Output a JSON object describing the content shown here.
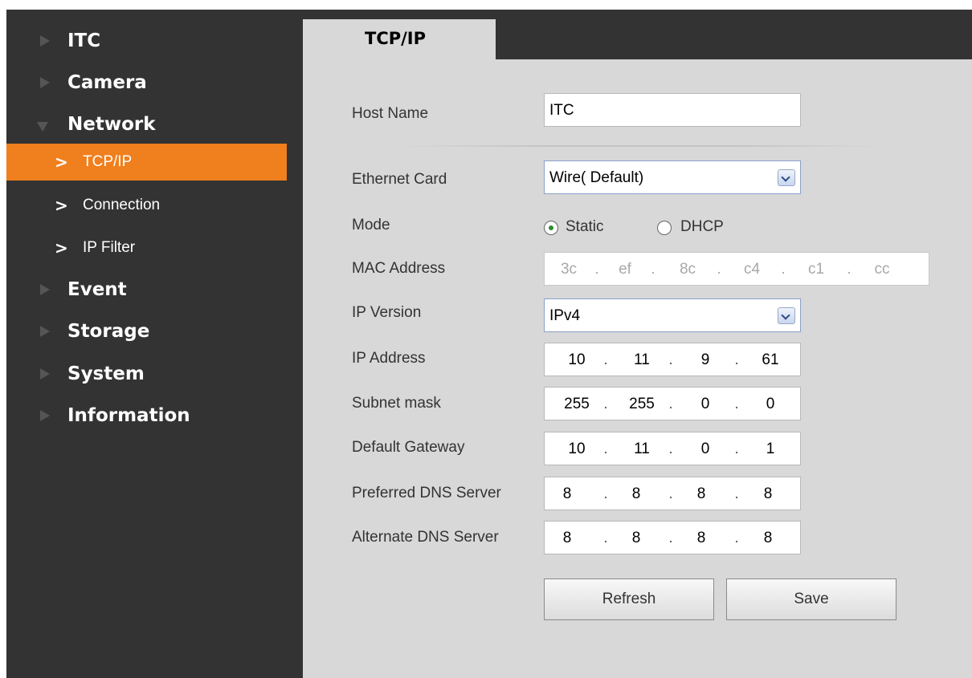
{
  "sidebar": {
    "items": [
      {
        "label": "ITC",
        "expanded": false
      },
      {
        "label": "Camera",
        "expanded": false
      },
      {
        "label": "Network",
        "expanded": true
      },
      {
        "label": "TCP/IP",
        "sub": true,
        "active": true
      },
      {
        "label": "Connection",
        "sub": true,
        "active": false
      },
      {
        "label": "IP Filter",
        "sub": true,
        "active": false
      },
      {
        "label": "Event",
        "expanded": false
      },
      {
        "label": "Storage",
        "expanded": false
      },
      {
        "label": "System",
        "expanded": false
      },
      {
        "label": "Information",
        "expanded": false
      }
    ]
  },
  "tab": {
    "label": "TCP/IP"
  },
  "form": {
    "host_name": {
      "label": "Host Name",
      "value": "ITC"
    },
    "ethernet_card": {
      "label": "Ethernet Card",
      "value": "Wire( Default)"
    },
    "mode": {
      "label": "Mode",
      "options": [
        "Static",
        "DHCP"
      ],
      "selected": "Static"
    },
    "mac_address": {
      "label": "MAC Address",
      "parts": [
        "3c",
        "ef",
        "8c",
        "c4",
        "c1",
        "cc"
      ]
    },
    "ip_version": {
      "label": "IP Version",
      "value": "IPv4"
    },
    "ip_address": {
      "label": "IP Address",
      "parts": [
        "10",
        "11",
        "9",
        "61"
      ]
    },
    "subnet_mask": {
      "label": "Subnet mask",
      "parts": [
        "255",
        "255",
        "0",
        "0"
      ]
    },
    "default_gateway": {
      "label": "Default Gateway",
      "parts": [
        "10",
        "11",
        "0",
        "1"
      ]
    },
    "preferred_dns": {
      "label": "Preferred DNS Server",
      "parts": [
        "8",
        "8",
        "8",
        "8"
      ]
    },
    "alternate_dns": {
      "label": "Alternate DNS Server",
      "parts": [
        "8",
        "8",
        "8",
        "8"
      ]
    }
  },
  "buttons": {
    "refresh": "Refresh",
    "save": "Save"
  },
  "colors": {
    "sidebar_bg": "#333333",
    "active_item": "#f07f1e",
    "content_bg": "#d8d8d8"
  }
}
